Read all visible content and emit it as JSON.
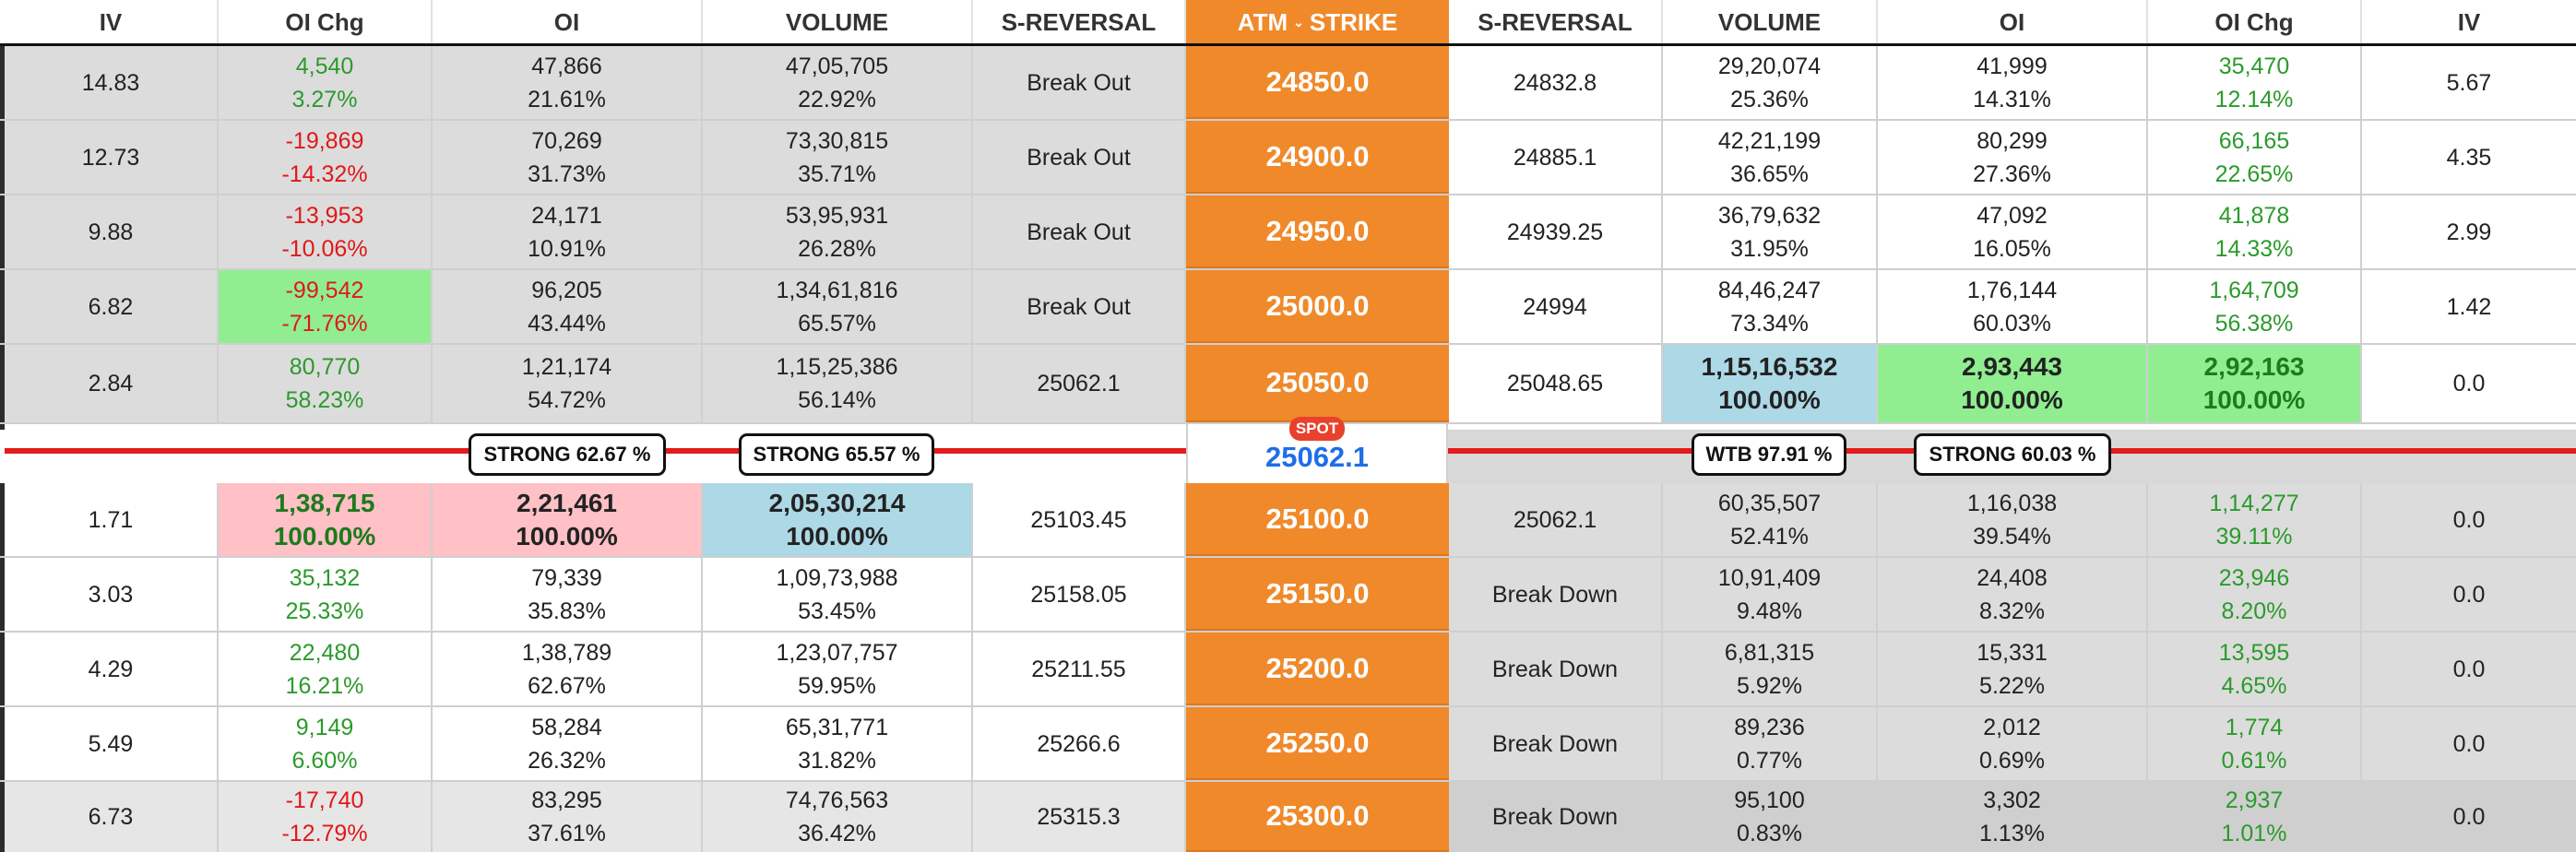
{
  "header": {
    "left": [
      "IV",
      "OI Chg",
      "OI",
      "VOLUME",
      "S-REVERSAL"
    ],
    "strike": {
      "atm": "ATM",
      "caret": "⌄",
      "label": "STRIKE"
    },
    "right": [
      "S-REVERSAL",
      "VOLUME",
      "OI",
      "OI Chg",
      "IV"
    ]
  },
  "rows_above": [
    {
      "iv_l": "14.83",
      "oichg_l": [
        "4,540",
        "3.27%"
      ],
      "oi_l": [
        "47,866",
        "21.61%"
      ],
      "vol_l": [
        "47,05,705",
        "22.92%"
      ],
      "srev_l": "Break Out",
      "strike": "24850.0",
      "srev_r": "24832.8",
      "vol_r": [
        "29,20,074",
        "25.36%"
      ],
      "oi_r": [
        "41,999",
        "14.31%"
      ],
      "oichg_r": [
        "35,470",
        "12.14%"
      ],
      "iv_r": "5.67"
    },
    {
      "iv_l": "12.73",
      "oichg_l": [
        "-19,869",
        "-14.32%"
      ],
      "oi_l": [
        "70,269",
        "31.73%"
      ],
      "vol_l": [
        "73,30,815",
        "35.71%"
      ],
      "srev_l": "Break Out",
      "strike": "24900.0",
      "srev_r": "24885.1",
      "vol_r": [
        "42,21,199",
        "36.65%"
      ],
      "oi_r": [
        "80,299",
        "27.36%"
      ],
      "oichg_r": [
        "66,165",
        "22.65%"
      ],
      "iv_r": "4.35"
    },
    {
      "iv_l": "9.88",
      "oichg_l": [
        "-13,953",
        "-10.06%"
      ],
      "oi_l": [
        "24,171",
        "10.91%"
      ],
      "vol_l": [
        "53,95,931",
        "26.28%"
      ],
      "srev_l": "Break Out",
      "strike": "24950.0",
      "srev_r": "24939.25",
      "vol_r": [
        "36,79,632",
        "31.95%"
      ],
      "oi_r": [
        "47,092",
        "16.05%"
      ],
      "oichg_r": [
        "41,878",
        "14.33%"
      ],
      "iv_r": "2.99"
    },
    {
      "iv_l": "6.82",
      "oichg_l": [
        "-99,542",
        "-71.76%"
      ],
      "oi_l": [
        "96,205",
        "43.44%"
      ],
      "vol_l": [
        "1,34,61,816",
        "65.57%"
      ],
      "srev_l": "Break Out",
      "strike": "25000.0",
      "srev_r": "24994",
      "vol_r": [
        "84,46,247",
        "73.34%"
      ],
      "oi_r": [
        "1,76,144",
        "60.03%"
      ],
      "oichg_r": [
        "1,64,709",
        "56.38%"
      ],
      "iv_r": "1.42"
    },
    {
      "iv_l": "2.84",
      "oichg_l": [
        "80,770",
        "58.23%"
      ],
      "oi_l": [
        "1,21,174",
        "54.72%"
      ],
      "vol_l": [
        "1,15,25,386",
        "56.14%"
      ],
      "srev_l": "25062.1",
      "strike": "25050.0",
      "srev_r": "25048.65",
      "vol_r": [
        "1,15,16,532",
        "100.00%"
      ],
      "oi_r": [
        "2,93,443",
        "100.00%"
      ],
      "oichg_r": [
        "2,92,163",
        "100.00%"
      ],
      "iv_r": "0.0"
    }
  ],
  "spot": {
    "tag": "SPOT",
    "value": "25062.1",
    "pills": [
      "STRONG 62.67 %",
      "STRONG 65.57 %",
      "WTB 97.91 %",
      "STRONG 60.03 %"
    ]
  },
  "rows_below": [
    {
      "iv_l": "1.71",
      "oichg_l": [
        "1,38,715",
        "100.00%"
      ],
      "oi_l": [
        "2,21,461",
        "100.00%"
      ],
      "vol_l": [
        "2,05,30,214",
        "100.00%"
      ],
      "srev_l": "25103.45",
      "strike": "25100.0",
      "srev_r": "25062.1",
      "vol_r": [
        "60,35,507",
        "52.41%"
      ],
      "oi_r": [
        "1,16,038",
        "39.54%"
      ],
      "oichg_r": [
        "1,14,277",
        "39.11%"
      ],
      "iv_r": "0.0"
    },
    {
      "iv_l": "3.03",
      "oichg_l": [
        "35,132",
        "25.33%"
      ],
      "oi_l": [
        "79,339",
        "35.83%"
      ],
      "vol_l": [
        "1,09,73,988",
        "53.45%"
      ],
      "srev_l": "25158.05",
      "strike": "25150.0",
      "srev_r": "Break Down",
      "vol_r": [
        "10,91,409",
        "9.48%"
      ],
      "oi_r": [
        "24,408",
        "8.32%"
      ],
      "oichg_r": [
        "23,946",
        "8.20%"
      ],
      "iv_r": "0.0"
    },
    {
      "iv_l": "4.29",
      "oichg_l": [
        "22,480",
        "16.21%"
      ],
      "oi_l": [
        "1,38,789",
        "62.67%"
      ],
      "vol_l": [
        "1,23,07,757",
        "59.95%"
      ],
      "srev_l": "25211.55",
      "strike": "25200.0",
      "srev_r": "Break Down",
      "vol_r": [
        "6,81,315",
        "5.92%"
      ],
      "oi_r": [
        "15,331",
        "5.22%"
      ],
      "oichg_r": [
        "13,595",
        "4.65%"
      ],
      "iv_r": "0.0"
    },
    {
      "iv_l": "5.49",
      "oichg_l": [
        "9,149",
        "6.60%"
      ],
      "oi_l": [
        "58,284",
        "26.32%"
      ],
      "vol_l": [
        "65,31,771",
        "31.82%"
      ],
      "srev_l": "25266.6",
      "strike": "25250.0",
      "srev_r": "Break Down",
      "vol_r": [
        "89,236",
        "0.77%"
      ],
      "oi_r": [
        "2,012",
        "0.69%"
      ],
      "oichg_r": [
        "1,774",
        "0.61%"
      ],
      "iv_r": "0.0"
    },
    {
      "iv_l": "6.73",
      "oichg_l": [
        "-17,740",
        "-12.79%"
      ],
      "oi_l": [
        "83,295",
        "37.61%"
      ],
      "vol_l": [
        "74,76,563",
        "36.42%"
      ],
      "srev_l": "25315.3",
      "strike": "25300.0",
      "srev_r": "Break Down",
      "vol_r": [
        "95,100",
        "0.83%"
      ],
      "oi_r": [
        "3,302",
        "1.13%"
      ],
      "oichg_r": [
        "2,937",
        "1.01%"
      ],
      "iv_r": "0.0"
    }
  ],
  "colors": {
    "strike": "#f0892a",
    "spot_value": "#1f6ee8",
    "positive": "#2b9a2b",
    "negative": "#e01818",
    "highlight_green": "#90ee90",
    "highlight_pink": "#ffc0c6",
    "highlight_blue": "#add8e6",
    "spot_line": "#e31b1b"
  }
}
